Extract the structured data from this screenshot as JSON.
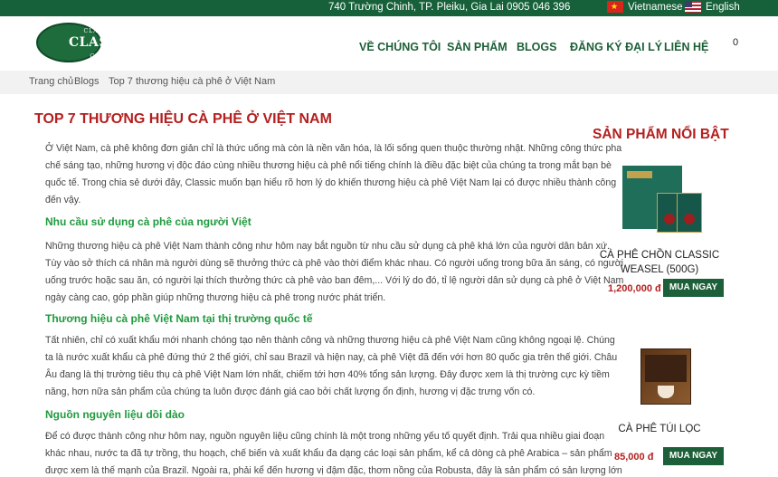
{
  "topbar": {
    "address": "740 Trường Chinh, TP. Pleiku, Gia Lai",
    "phone": "0905 046 396",
    "lang_vi": "Vietnamese",
    "lang_en": "English"
  },
  "header": {
    "logo_top": "CLASSIC",
    "logo_main": "CLASSIC",
    "logo_bottom": "Coffee",
    "nav": [
      "VỀ CHÚNG TÔI",
      "SẢN PHẨM",
      "BLOGS",
      "ĐĂNG KÝ ĐẠI LÝ",
      "LIÊN HỆ"
    ],
    "cart_count": "0"
  },
  "breadcrumb": [
    "Trang chủ",
    "Blogs",
    "Top 7 thương hiệu cà phê ở Việt Nam"
  ],
  "article": {
    "title": "TOP 7 THƯƠNG HIỆU CÀ PHÊ Ở VIỆT NAM",
    "p1": [
      "Ở Việt Nam, cà phê không đơn giản chỉ là thức uống mà còn là nền văn hóa, là lối sống quen thuộc thường nhật. Những công thức pha",
      "chế sáng tạo, những hương vị độc đáo cùng nhiều thương hiệu cà phê nổi tiếng chính là điều đặc biệt của chúng ta trong mắt bạn bè",
      "quốc tế. Trong chia sẻ dưới đây, Classic muốn bạn hiểu rõ hơn lý do khiến thương hiệu cà phê Việt Nam lại có được nhiều thành công",
      "đến vậy."
    ],
    "h1": "Nhu cầu sử dụng cà phê của người Việt",
    "p2": [
      "Những thương hiệu cà phê Việt Nam thành công như hôm nay bắt nguồn từ nhu cầu sử dụng cà phê khá lớn của người dân bản xứ.",
      "Tùy vào sở thích cá nhân mà người dùng sẽ thưởng thức cà phê vào thời điểm khác nhau. Có người uống trong bữa ăn sáng, có người",
      "uống trước hoặc sau ăn, có người lại thích thưởng thức cà phê vào ban đêm,... Với lý do đó, tỉ lệ người dân sử dụng cà phê ở Việt Nam",
      "ngày càng cao, góp phần giúp những thương hiệu cà phê trong nước phát triển."
    ],
    "h2": "Thương hiệu cà phê Việt Nam tại thị trường quốc tế",
    "p3": [
      "Tất nhiên, chỉ có xuất khẩu mới nhanh chóng tạo nên thành công và những thương hiệu cà phê Việt Nam  cũng không ngoại lệ. Chúng",
      "ta là nước xuất khẩu cà phê đứng thứ 2 thế giới, chỉ sau Brazil và hiện nay, cà phê Việt đã đến với hơn 80 quốc gia trên thế giới. Châu",
      "Âu đang là thị trường tiêu thụ cà phê Việt Nam lớn nhất, chiếm tới hơn 40% tổng sản lượng. Đây được xem là thị trường cực kỳ tiềm",
      "năng, hơn nữa sản phẩm của chúng ta luôn được đánh giá cao bởi chất lượng ổn định, hương vị đặc trưng vốn có."
    ],
    "h3": "Nguồn nguyên liệu dồi dào",
    "p4": [
      "Để có được thành công như hôm nay, nguồn nguyên liệu cũng chính là một trong những yếu tố quyết định. Trải qua nhiều giai đoạn",
      "khác nhau, nước ta đã tự trồng, thu hoạch, chế biến và xuất khẩu đa dạng các loại sản phẩm, kể cả dòng cà phê Arabica – sản phẩm",
      "được xem là thế mạnh của Brazil. Ngoài ra, phải kể đến hương vị đậm đặc, thơm nồng của Robusta, đây là sản phẩm có sản lượng lớn"
    ]
  },
  "sidebar": {
    "title": "SẢN PHẨM NỔI BẬT",
    "products": [
      {
        "name_line1": "CÀ PHÊ CHỒN CLASSIC",
        "name_line2": "WEASEL (500G)",
        "price": "1,200,000 đ",
        "buy": "MUA NGAY"
      },
      {
        "name_line1": "CÀ PHÊ TÚI LỌC",
        "price": "85,000 đ",
        "buy": "MUA NGAY"
      }
    ]
  }
}
